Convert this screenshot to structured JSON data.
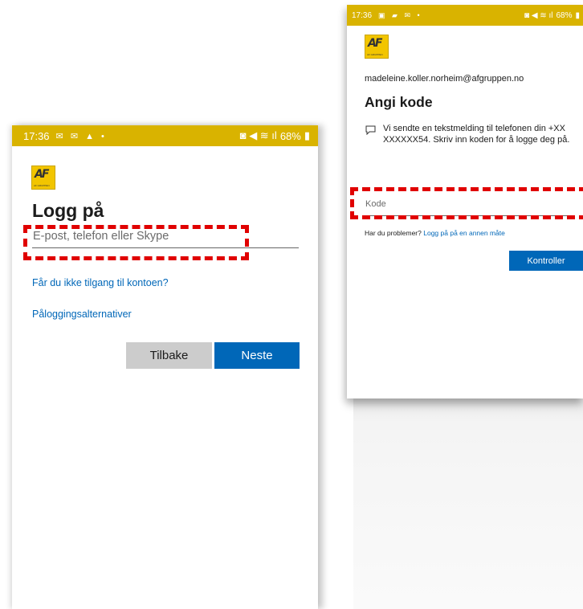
{
  "left_phone": {
    "status": {
      "time": "17:36",
      "icons": "✉ ✉ ▲ •",
      "right": "68%"
    },
    "title": "Logg på",
    "email_placeholder": "E-post, telefon eller Skype",
    "no_access_link": "Får du ikke tilgang til kontoen?",
    "signin_options_link": "Påloggingsalternativer",
    "back_button": "Tilbake",
    "next_button": "Neste"
  },
  "right_phone": {
    "status": {
      "time": "17:36",
      "icons": "▣ ▰ ✉ •",
      "right": "68%"
    },
    "email": "madeleine.koller.norheim@afgruppen.no",
    "title": "Angi kode",
    "message": "Vi sendte en tekstmelding til telefonen din +XX XXXXXX54. Skriv inn koden for å logge deg på.",
    "code_placeholder": "Kode",
    "problem_text": "Har du problemer?",
    "problem_link": "Logg på på en annen måte",
    "verify_button": "Kontroller"
  },
  "logo": {
    "mark": "AF",
    "sub": "AF GRUPPEN"
  },
  "colors": {
    "statusbar": "#d9b300",
    "primary": "#0067b8",
    "highlight": "#e00000"
  }
}
